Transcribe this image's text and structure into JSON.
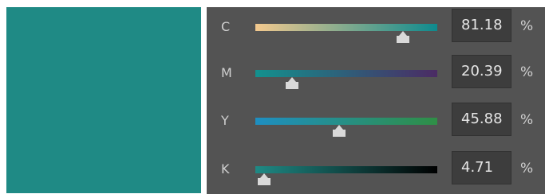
{
  "swatch": {
    "color": "#1f8a85"
  },
  "panel": {
    "background": "#535353"
  },
  "channels": [
    {
      "label": "C",
      "value": "81.18",
      "unit": "%",
      "slider_fraction": 0.8118,
      "gradient": [
        "#f3c98e",
        "#0e8a8e"
      ]
    },
    {
      "label": "M",
      "value": "20.39",
      "unit": "%",
      "slider_fraction": 0.2039,
      "gradient": [
        "#13918e",
        "#4b2b64"
      ]
    },
    {
      "label": "Y",
      "value": "45.88",
      "unit": "%",
      "slider_fraction": 0.4588,
      "gradient": [
        "#1e8fc2",
        "#2f8f46"
      ]
    },
    {
      "label": "K",
      "value": "4.71",
      "unit": "%",
      "slider_fraction": 0.0471,
      "gradient": [
        "#1f8a85",
        "#000000"
      ]
    }
  ]
}
